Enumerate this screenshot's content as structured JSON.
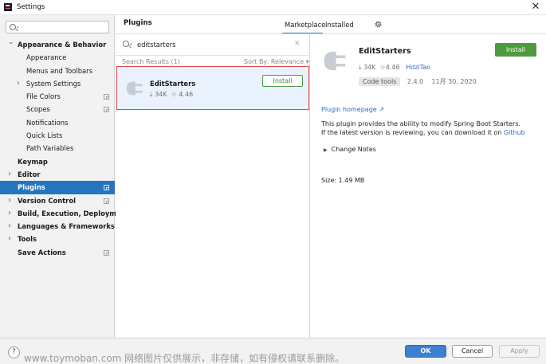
{
  "window": {
    "title": "Settings",
    "close_glyph": "✕"
  },
  "sidebar": {
    "search_placeholder": "",
    "items": [
      {
        "label": "Appearance & Behavior",
        "level": 0,
        "bold": true,
        "expanded": true,
        "has_arrow": true
      },
      {
        "label": "Appearance",
        "level": 1
      },
      {
        "label": "Menus and Toolbars",
        "level": 1
      },
      {
        "label": "System Settings",
        "level": 1,
        "has_arrow": true
      },
      {
        "label": "File Colors",
        "level": 1,
        "project_icon": true
      },
      {
        "label": "Scopes",
        "level": 1,
        "project_icon": true
      },
      {
        "label": "Notifications",
        "level": 1
      },
      {
        "label": "Quick Lists",
        "level": 1
      },
      {
        "label": "Path Variables",
        "level": 1
      },
      {
        "label": "Keymap",
        "level": 0,
        "bold": true
      },
      {
        "label": "Editor",
        "level": 0,
        "bold": true,
        "has_arrow": true
      },
      {
        "label": "Plugins",
        "level": 0,
        "bold": true,
        "selected": true,
        "project_icon": true
      },
      {
        "label": "Version Control",
        "level": 0,
        "bold": true,
        "has_arrow": true,
        "project_icon": true
      },
      {
        "label": "Build, Execution, Deployment",
        "level": 0,
        "bold": true,
        "has_arrow": true
      },
      {
        "label": "Languages & Frameworks",
        "level": 0,
        "bold": true,
        "has_arrow": true
      },
      {
        "label": "Tools",
        "level": 0,
        "bold": true,
        "has_arrow": true
      },
      {
        "label": "Save Actions",
        "level": 0,
        "bold": true,
        "project_icon": true
      }
    ]
  },
  "plugins": {
    "title": "Plugins",
    "tabs": {
      "marketplace": "Marketplace",
      "installed": "Installed"
    },
    "search_value": "editstarters",
    "results_label": "Search Results (1)",
    "sort_label": "Sort By: Relevance ▾",
    "result": {
      "name": "EditStarters",
      "downloads": "34K",
      "rating": "4.46",
      "install_label": "Install"
    }
  },
  "detail": {
    "name": "EditStarters",
    "install_label": "Install",
    "downloads": "34K",
    "rating": "4.46",
    "vendor": "HdziTao",
    "tag": "Code tools",
    "version": "2.4.0",
    "date": "11月 30, 2020",
    "homepage_link": "Plugin homepage ↗",
    "description_line1": "This plugin provides the ability to modify Spring Boot Starters.",
    "description_line2_prefix": "If the latest version is reviewing, you can download it on",
    "description_line2_link": "Github",
    "change_notes": "Change Notes",
    "size": "Size: 1.49 MB"
  },
  "footer": {
    "help": "?",
    "watermark": "www.toymoban.com 网络图片仅供展示，非存储，如有侵权请联系删除。",
    "ok": "OK",
    "cancel": "Cancel",
    "apply": "Apply"
  },
  "colors": {
    "accent": "#2675bf",
    "install_green": "#4e9a3c",
    "highlight_red": "#e04848",
    "link": "#2a6bc8"
  }
}
